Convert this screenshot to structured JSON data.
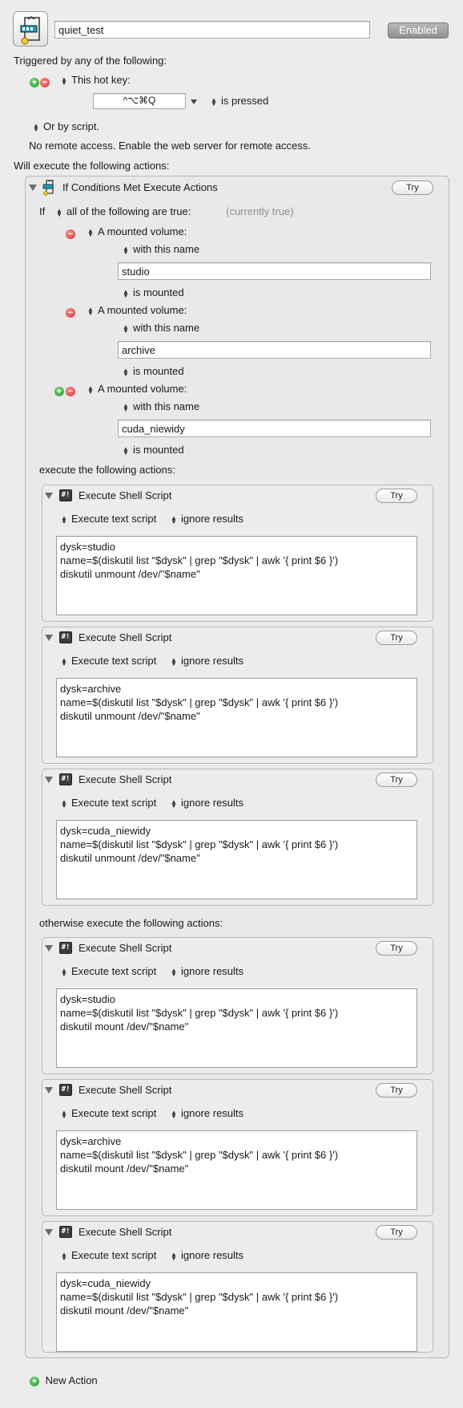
{
  "macro": {
    "name": "quiet_test",
    "enabled_label": "Enabled"
  },
  "triggers": {
    "heading": "Triggered by any of the following:",
    "hotkey_label": "This hot key:",
    "hotkey_value": "^⌥⌘Q",
    "hotkey_condition": "is pressed",
    "script_label": "Or by script.",
    "remote_text": "No remote access.  Enable the web server for remote access."
  },
  "actions_heading": "Will execute the following actions:",
  "if_action": {
    "title": "If Conditions Met Execute Actions",
    "try_label": "Try",
    "if_label": "If",
    "match_label": "all of the following are true:",
    "status": "(currently true)",
    "conditions": [
      {
        "type_label": "A mounted volume:",
        "name_label": "with this name",
        "value": "studio",
        "state_label": "is mounted"
      },
      {
        "type_label": "A mounted volume:",
        "name_label": "with this name",
        "value": "archive",
        "state_label": "is mounted"
      },
      {
        "type_label": "A mounted volume:",
        "name_label": "with this name",
        "value": "cuda_niewidy",
        "state_label": "is mounted"
      }
    ],
    "then_heading": "execute the following actions:",
    "else_heading": "otherwise execute the following actions:"
  },
  "shell_common": {
    "title": "Execute Shell Script",
    "try_label": "Try",
    "mode_label": "Execute text script",
    "result_label": "ignore results"
  },
  "then_scripts": [
    "dysk=studio\nname=$(diskutil list \"$dysk\" | grep \"$dysk\" | awk '{ print $6 }')\ndiskutil unmount /dev/\"$name\"",
    "dysk=archive\nname=$(diskutil list \"$dysk\" | grep \"$dysk\" | awk '{ print $6 }')\ndiskutil unmount /dev/\"$name\"",
    "dysk=cuda_niewidy\nname=$(diskutil list \"$dysk\" | grep \"$dysk\" | awk '{ print $6 }')\ndiskutil unmount /dev/\"$name\""
  ],
  "else_scripts": [
    "dysk=studio\nname=$(diskutil list \"$dysk\" | grep \"$dysk\" | awk '{ print $6 }')\ndiskutil mount /dev/\"$name\"",
    "dysk=archive\nname=$(diskutil list \"$dysk\" | grep \"$dysk\" | awk '{ print $6 }')\ndiskutil mount /dev/\"$name\"",
    "dysk=cuda_niewidy\nname=$(diskutil list \"$dysk\" | grep \"$dysk\" | awk '{ print $6 }')\ndiskutil mount /dev/\"$name\""
  ],
  "new_action_label": "New Action",
  "icons": {
    "macro": "macro-group-icon",
    "if_action": "if-then-else-icon",
    "shell": "shell-script-icon"
  }
}
